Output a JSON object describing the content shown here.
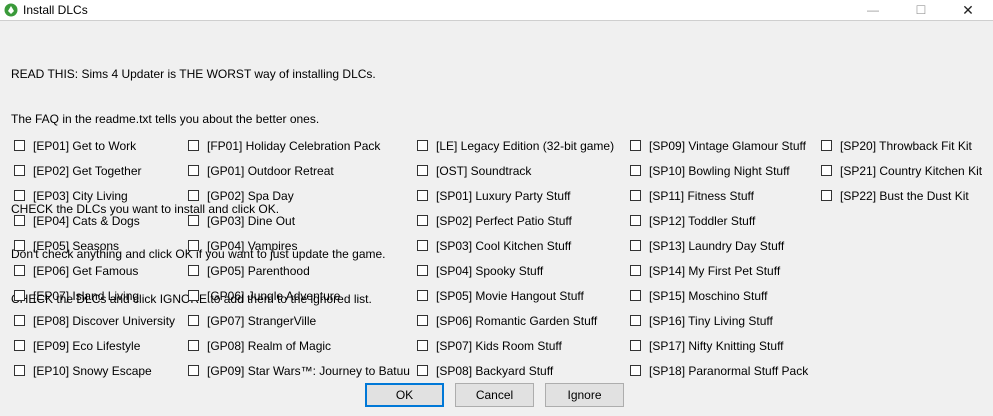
{
  "window": {
    "title": "Install DLCs",
    "min_glyph": "—",
    "max_glyph": "☐",
    "close_glyph": "✕"
  },
  "notes": [
    "READ THIS: Sims 4 Updater is THE WORST way of installing DLCs.",
    "The FAQ in the readme.txt tells you about the better ones.",
    "",
    "CHECK the DLCs you want to install and click OK.",
    "Don't check anything and click OK if you want to just update the game.",
    "CHECK the DLCs and click IGNORE to add them to the ignored list."
  ],
  "columns": [
    [
      "[EP01] Get to Work",
      "[EP02] Get Together",
      "[EP03] City Living",
      "[EP04] Cats & Dogs",
      "[EP05] Seasons",
      "[EP06] Get Famous",
      "[EP07] Island Living",
      "[EP08] Discover University",
      "[EP09] Eco Lifestyle",
      "[EP10] Snowy Escape"
    ],
    [
      "[FP01] Holiday Celebration Pack",
      "[GP01] Outdoor Retreat",
      "[GP02] Spa Day",
      "[GP03] Dine Out",
      "[GP04] Vampires",
      "[GP05] Parenthood",
      "[GP06] Jungle Adventure",
      "[GP07] StrangerVille",
      "[GP08] Realm of Magic",
      "[GP09] Star Wars™: Journey to Batuu"
    ],
    [
      "[LE] Legacy Edition (32-bit game)",
      "[OST] Soundtrack",
      "[SP01] Luxury Party Stuff",
      "[SP02] Perfect Patio Stuff",
      "[SP03] Cool Kitchen Stuff",
      "[SP04] Spooky Stuff",
      "[SP05] Movie Hangout Stuff",
      "[SP06] Romantic Garden Stuff",
      "[SP07] Kids Room Stuff",
      "[SP08] Backyard Stuff"
    ],
    [
      "[SP09] Vintage Glamour Stuff",
      "[SP10] Bowling Night Stuff",
      "[SP11] Fitness Stuff",
      "[SP12] Toddler Stuff",
      "[SP13] Laundry Day Stuff",
      "[SP14] My First Pet Stuff",
      "[SP15] Moschino Stuff",
      "[SP16] Tiny Living Stuff",
      "[SP17] Nifty Knitting Stuff",
      "[SP18] Paranormal Stuff Pack"
    ],
    [
      "[SP20] Throwback Fit Kit",
      "[SP21] Country Kitchen Kit",
      "[SP22] Bust the Dust Kit"
    ]
  ],
  "buttons": {
    "ok": "OK",
    "cancel": "Cancel",
    "ignore": "Ignore"
  }
}
